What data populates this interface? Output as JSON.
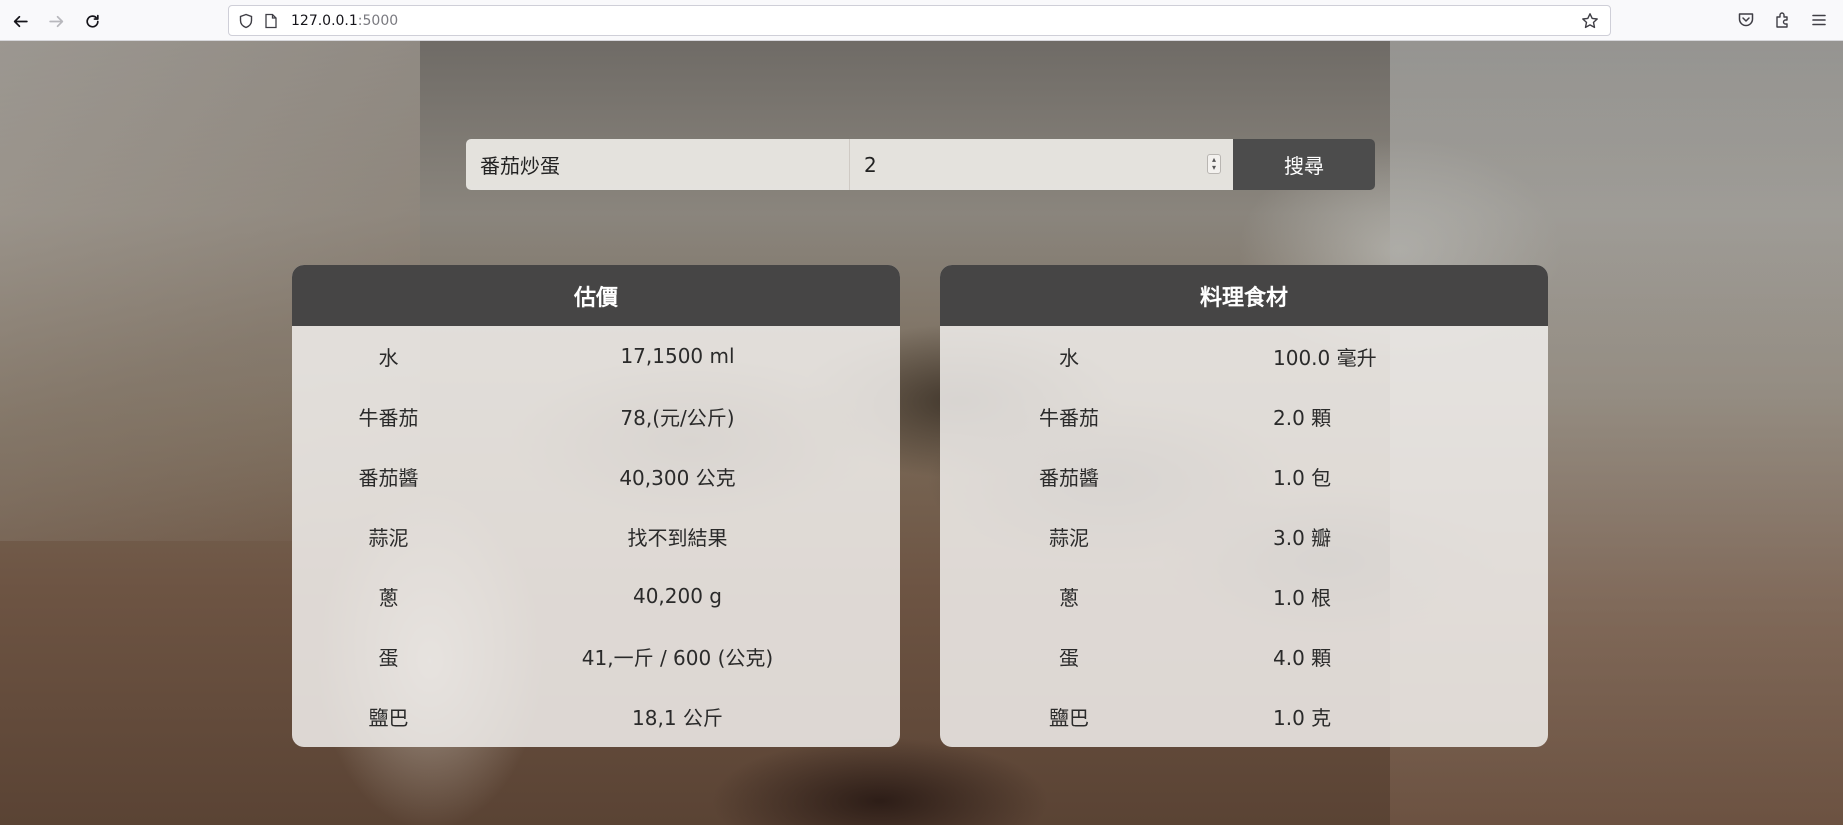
{
  "browser": {
    "url_host": "127.0.0.1",
    "url_port": ":5000"
  },
  "search": {
    "dish_value": "番茄炒蛋",
    "quantity_value": "2",
    "button_label": "搜尋"
  },
  "price_card": {
    "title": "估價",
    "rows": [
      {
        "name": "水",
        "value": "17,1500 ml"
      },
      {
        "name": "牛番茄",
        "value": "78,(元/公斤)"
      },
      {
        "name": "番茄醬",
        "value": "40,300 公克"
      },
      {
        "name": "蒜泥",
        "value": "找不到結果"
      },
      {
        "name": "蔥",
        "value": "40,200 g"
      },
      {
        "name": "蛋",
        "value": "41,一斤 / 600 (公克)"
      },
      {
        "name": "鹽巴",
        "value": "18,1 公斤"
      }
    ]
  },
  "ingredient_card": {
    "title": "料理食材",
    "rows": [
      {
        "name": "水",
        "value": "100.0 毫升"
      },
      {
        "name": "牛番茄",
        "value": "2.0 顆"
      },
      {
        "name": "番茄醬",
        "value": "1.0 包"
      },
      {
        "name": "蒜泥",
        "value": "3.0 瓣"
      },
      {
        "name": "蔥",
        "value": "1.0 根"
      },
      {
        "name": "蛋",
        "value": "4.0 顆"
      },
      {
        "name": "鹽巴",
        "value": "1.0 克"
      }
    ]
  }
}
